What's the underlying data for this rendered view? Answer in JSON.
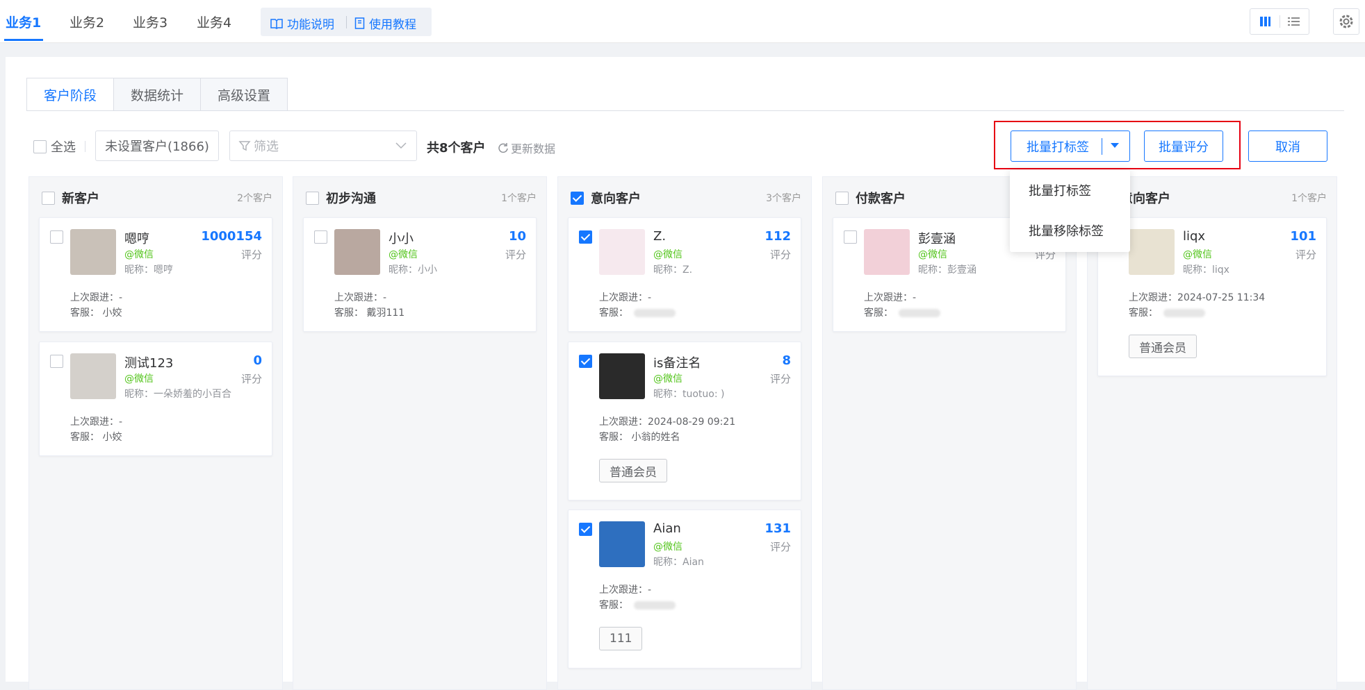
{
  "business_tabs": [
    "业务1",
    "业务2",
    "业务3",
    "业务4"
  ],
  "help_links": {
    "features": "功能说明",
    "tutorial": "使用教程"
  },
  "sub_tabs": [
    "客户阶段",
    "数据统计",
    "高级设置"
  ],
  "toolbar": {
    "select_all": "全选",
    "unassigned": "未设置客户(1866)",
    "filter_placeholder": "筛选",
    "total": "共8个客户",
    "refresh": "更新数据",
    "batch_tag": "批量打标签",
    "batch_score": "批量评分",
    "cancel": "取消"
  },
  "dropdown": [
    "批量打标签",
    "批量移除标签"
  ],
  "columns": [
    {
      "title": "新客户",
      "count": "2个客户",
      "checked": false,
      "cards": [
        {
          "name": "嗯哼",
          "source": "@微信",
          "nickname": "昵称：嗯哼",
          "score": "1000154",
          "score_label": "评分",
          "follow": "上次跟进：-",
          "service": "客服：  小姣",
          "tag": "",
          "checked": false
        },
        {
          "name": "测试123",
          "source": "@微信",
          "nickname": "昵称：一朵娇羞的小百合",
          "score": "0",
          "score_label": "评分",
          "follow": "上次跟进：-",
          "service": "客服：  小姣",
          "tag": "",
          "checked": false
        }
      ]
    },
    {
      "title": "初步沟通",
      "count": "1个客户",
      "checked": false,
      "cards": [
        {
          "name": "小小",
          "source": "@微信",
          "nickname": "昵称：小小",
          "score": "10",
          "score_label": "评分",
          "follow": "上次跟进：-",
          "service": "客服：  戴羽111",
          "tag": "",
          "checked": false
        }
      ]
    },
    {
      "title": "意向客户",
      "count": "3个客户",
      "checked": true,
      "cards": [
        {
          "name": "Z.",
          "source": "@微信",
          "nickname": "昵称：Z.",
          "score": "112",
          "score_label": "评分",
          "follow": "上次跟进：-",
          "service": "客服：",
          "tag": "",
          "checked": true
        },
        {
          "name": "is备注名",
          "source": "@微信",
          "nickname": "昵称：tuotuo: )",
          "score": "8",
          "score_label": "评分",
          "follow": "上次跟进：2024-08-29 09:21",
          "service": "客服：  小翁的姓名",
          "tag": "普通会员",
          "checked": true
        },
        {
          "name": "Aian",
          "source": "@微信",
          "nickname": "昵称：Aian",
          "score": "131",
          "score_label": "评分",
          "follow": "上次跟进：-",
          "service": "客服：",
          "tag": "111",
          "checked": true
        }
      ]
    },
    {
      "title": "付款客户",
      "count": "",
      "checked": false,
      "cards": [
        {
          "name": "彭壹涵",
          "source": "@微信",
          "nickname": "昵称：彭壹涵",
          "score": "",
          "score_label": "评分",
          "follow": "上次跟进：-",
          "service": "客服：",
          "tag": "",
          "checked": false
        }
      ]
    },
    {
      "title": "意向客户",
      "count": "1个客户",
      "checked": false,
      "cards": [
        {
          "name": "liqx",
          "source": "@微信",
          "nickname": "昵称：liqx",
          "score": "101",
          "score_label": "评分",
          "follow": "上次跟进：2024-07-25 11:34",
          "service": "客服：",
          "tag": "普通会员",
          "checked": false
        }
      ]
    }
  ],
  "colors": {
    "primary": "#1677ff",
    "wechat": "#52c41a",
    "highlight": "#e60012"
  }
}
